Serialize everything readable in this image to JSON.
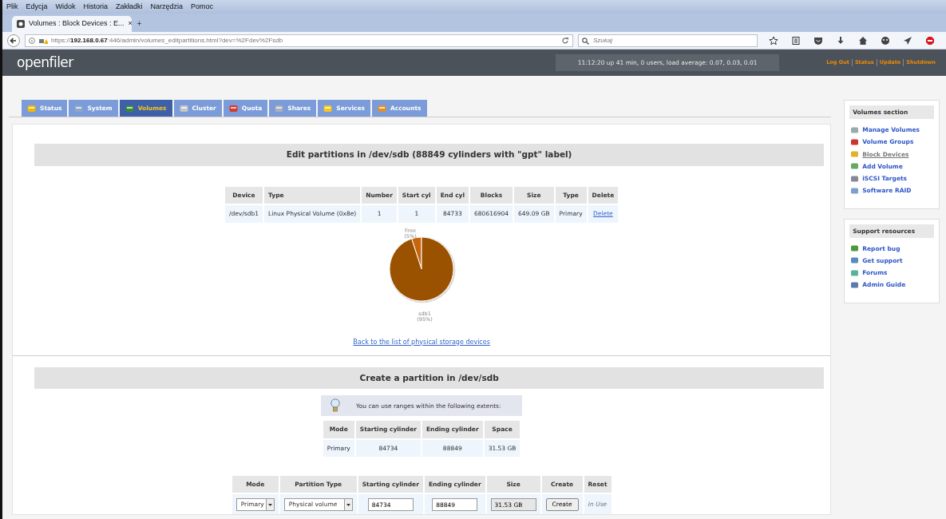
{
  "browser": {
    "menu": [
      "Plik",
      "Edycja",
      "Widok",
      "Historia",
      "Zakładki",
      "Narzędzia",
      "Pomoc"
    ],
    "tab": {
      "title": "Volumes : Block Devices : E...",
      "close": "×"
    },
    "new_tab": "+",
    "address": "https://**192.168.0.67**:446/admin/volumes_editpartitions.html?dev=%2Fdev%2Fsdb",
    "search": {
      "placeholder": "Szukaj"
    }
  },
  "header": {
    "logo": "openfiler",
    "uptime": "11:12:20 up 41 min, 0 users, load average: 0.07, 0.03, 0.01",
    "links": [
      "Log Out",
      "Status",
      "Update",
      "Shutdown"
    ]
  },
  "nav_tabs": [
    {
      "label": "Status",
      "selected": false
    },
    {
      "label": "System",
      "selected": false
    },
    {
      "label": "Volumes",
      "selected": true
    },
    {
      "label": "Cluster",
      "selected": false
    },
    {
      "label": "Quota",
      "selected": false
    },
    {
      "label": "Shares",
      "selected": false
    },
    {
      "label": "Services",
      "selected": false
    },
    {
      "label": "Accounts",
      "selected": false
    }
  ],
  "partitions": {
    "title": "Edit partitions in /dev/sdb (88849 cylinders with \"gpt\" label)",
    "columns": [
      "Device",
      "Type",
      "Number",
      "Start cyl",
      "End cyl",
      "Blocks",
      "Size",
      "Type",
      "Delete"
    ],
    "rows": [
      [
        "/dev/sdb1",
        "Linux Physical Volume (0x8e)",
        "1",
        "1",
        "84733",
        "680616904",
        "649.09 GB",
        "Primary",
        "Delete"
      ]
    ],
    "chart_data": {
      "type": "pie",
      "categories": [
        "Free",
        "sdb1"
      ],
      "values": [
        5,
        95
      ],
      "value_labels": [
        "(5%)",
        "(95%)"
      ]
    },
    "back_link": "Back to the list of physical storage devices"
  },
  "create": {
    "title": "Create a partition in /dev/sdb",
    "tip": "You can use ranges within the following extents:",
    "extents": {
      "columns": [
        "Mode",
        "Starting cylinder",
        "Ending cylinder",
        "Space"
      ],
      "rows": [
        [
          "Primary",
          "84734",
          "88849",
          "31.53 GB"
        ]
      ]
    },
    "form": {
      "columns": [
        "Mode",
        "Partition Type",
        "Starting cylinder",
        "Ending cylinder",
        "Size",
        "Create",
        "Reset"
      ],
      "mode": "Primary",
      "partition_type": "Physical volume",
      "start": "84734",
      "end": "88849",
      "size": "31.53 GB",
      "create_button": "Create",
      "reset": "In Use"
    }
  },
  "sidebar": [
    {
      "title": "Volumes section",
      "items": [
        {
          "label": "Manage Volumes",
          "selected": false
        },
        {
          "label": "Volume Groups",
          "selected": false
        },
        {
          "label": "Block Devices",
          "selected": true
        },
        {
          "label": "Add Volume",
          "selected": false
        },
        {
          "label": "iSCSI Targets",
          "selected": false
        },
        {
          "label": "Software RAID",
          "selected": false
        }
      ]
    },
    {
      "title": "Support resources",
      "items": [
        {
          "label": "Report bug",
          "selected": false
        },
        {
          "label": "Get support",
          "selected": false
        },
        {
          "label": "Forums",
          "selected": false
        },
        {
          "label": "Admin Guide",
          "selected": false
        }
      ]
    }
  ]
}
